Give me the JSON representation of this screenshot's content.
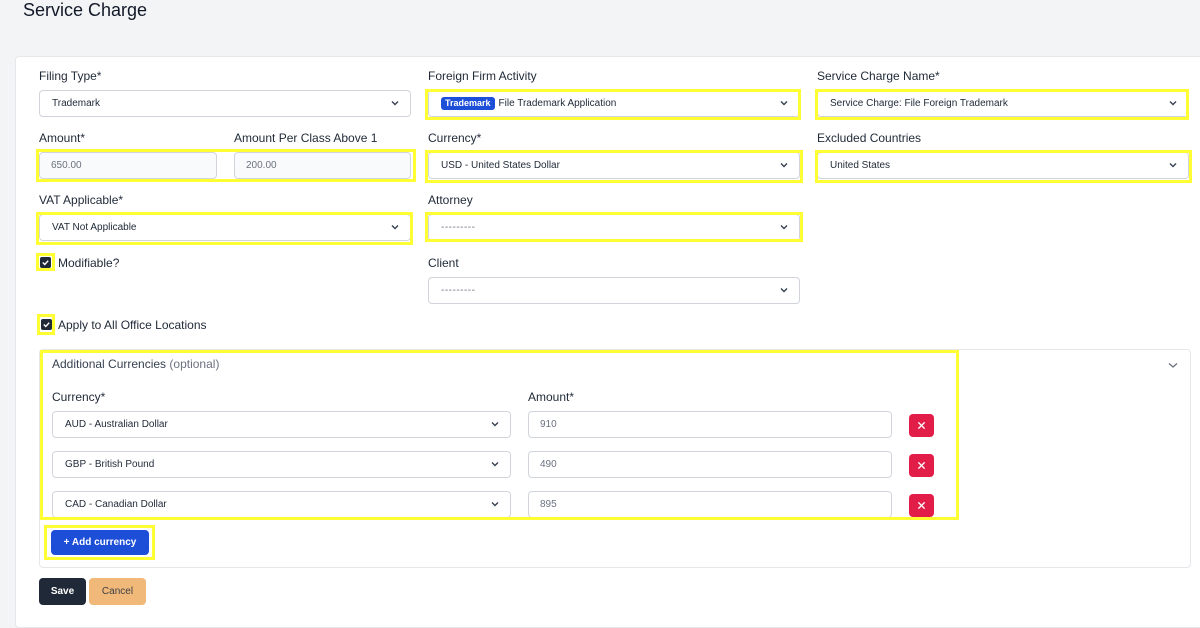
{
  "page": {
    "title": "Service Charge"
  },
  "form": {
    "filing_type": {
      "label": "Filing Type*",
      "value": "Trademark"
    },
    "foreign_firm_activity": {
      "label": "Foreign Firm Activity",
      "badge": "Trademark",
      "value": "File Trademark Application"
    },
    "service_charge_name": {
      "label": "Service Charge Name*",
      "value": "Service Charge: File Foreign Trademark"
    },
    "amount": {
      "label": "Amount*",
      "value": "650.00"
    },
    "amount_per_class": {
      "label": "Amount Per Class Above 1",
      "value": "200.00"
    },
    "currency": {
      "label": "Currency*",
      "value": "USD - United States Dollar"
    },
    "excluded_countries": {
      "label": "Excluded Countries",
      "value": "United States"
    },
    "vat_applicable": {
      "label": "VAT Applicable*",
      "value": "VAT Not Applicable"
    },
    "attorney": {
      "label": "Attorney",
      "value": "---------"
    },
    "modifiable": {
      "label": "Modifiable?",
      "checked": true
    },
    "client": {
      "label": "Client",
      "value": "---------"
    },
    "apply_all_locations": {
      "label": "Apply to All Office Locations",
      "checked": true
    }
  },
  "additional_currencies": {
    "title": "Additional Currencies",
    "optional": "(optional)",
    "currency_header": "Currency*",
    "amount_header": "Amount*",
    "rows": [
      {
        "currency": "AUD - Australian Dollar",
        "amount": "910"
      },
      {
        "currency": "GBP - British Pound",
        "amount": "490"
      },
      {
        "currency": "CAD - Canadian Dollar",
        "amount": "895"
      }
    ],
    "add_button": "+ Add currency"
  },
  "actions": {
    "save": "Save",
    "cancel": "Cancel"
  },
  "colors": {
    "highlight": "#ffff33",
    "primary": "#1d4ed8",
    "danger": "#e11d48",
    "save_bg": "#1f2937",
    "cancel_bg": "#f0b97a"
  }
}
